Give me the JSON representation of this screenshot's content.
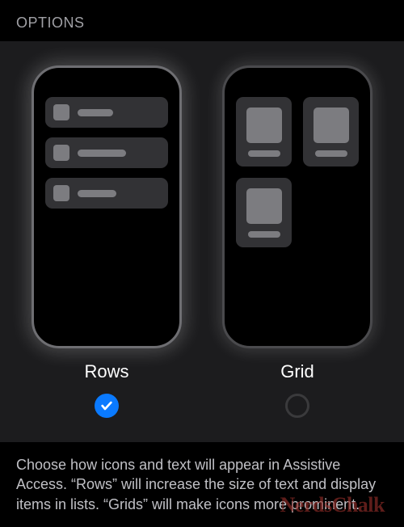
{
  "header": {
    "title": "OPTIONS"
  },
  "options": {
    "rows": {
      "label": "Rows",
      "selected": true
    },
    "grid": {
      "label": "Grid",
      "selected": false
    }
  },
  "footer": {
    "description": "Choose how icons and text will appear in Assistive Access. “Rows” will increase the size of text and display items in lists. “Grids” will make icons more prominent."
  },
  "watermark": {
    "text": "NerdsChalk"
  }
}
